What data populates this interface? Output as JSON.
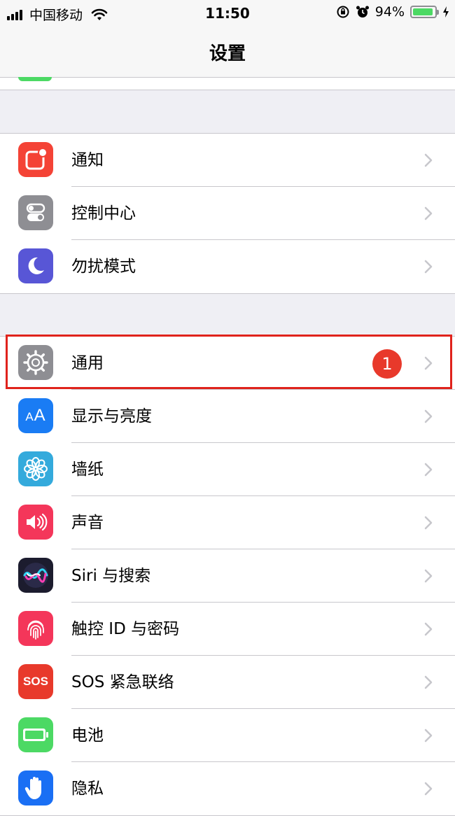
{
  "status_bar": {
    "carrier": "中国移动",
    "time": "11:50",
    "battery_percent": "94%",
    "battery_level": 0.94,
    "icons": [
      "signal-icon",
      "wifi-icon",
      "orientation-lock-icon",
      "alarm-icon",
      "battery-icon",
      "charging-icon"
    ]
  },
  "nav": {
    "title": "设置"
  },
  "groups": [
    {
      "rows": [
        {
          "label": "通知",
          "icon": "notifications-icon",
          "color": "#f44336"
        },
        {
          "label": "控制中心",
          "icon": "control-center-icon",
          "color": "#8e8e93"
        },
        {
          "label": "勿扰模式",
          "icon": "do-not-disturb-icon",
          "color": "#5856d6"
        }
      ]
    },
    {
      "rows": [
        {
          "label": "通用",
          "icon": "general-gear-icon",
          "color": "#8e8e93",
          "badge": "1",
          "highlighted": true
        },
        {
          "label": "显示与亮度",
          "icon": "display-brightness-icon",
          "color": "#1a7cf4"
        },
        {
          "label": "墙纸",
          "icon": "wallpaper-icon",
          "color": "#34aadc"
        },
        {
          "label": "声音",
          "icon": "sounds-icon",
          "color": "#f4365a"
        },
        {
          "label": "Siri 与搜索",
          "icon": "siri-icon",
          "color": "#1c1c2e"
        },
        {
          "label": "触控 ID 与密码",
          "icon": "touch-id-icon",
          "color": "#f4365a"
        },
        {
          "label": "SOS 紧急联络",
          "icon": "sos-icon",
          "color": "#e8392b",
          "icon_text": "SOS"
        },
        {
          "label": "电池",
          "icon": "battery-settings-icon",
          "color": "#4cd964"
        },
        {
          "label": "隐私",
          "icon": "privacy-hand-icon",
          "color": "#1a6ff4"
        }
      ]
    }
  ]
}
